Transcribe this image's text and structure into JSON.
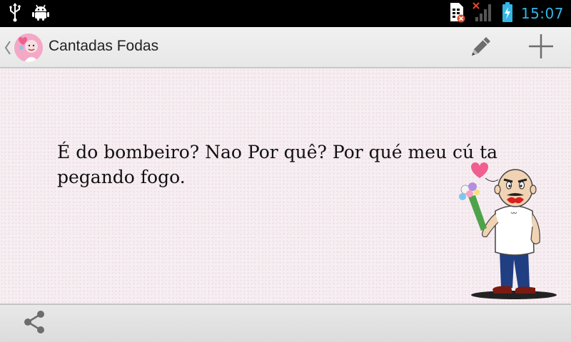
{
  "status_bar": {
    "time": "15:07",
    "time_color": "#34b5e5",
    "left_icons": [
      "usb-icon",
      "android-debug-icon"
    ],
    "right_icons": [
      "sim-missing-icon",
      "no-signal-icon",
      "battery-charging-icon"
    ]
  },
  "action_bar": {
    "title": "Cantadas Fodas",
    "actions": [
      "edit-icon",
      "add-icon"
    ]
  },
  "content": {
    "pickup_line": "É do bombeiro? Nao Por quê? Por qué meu cú ta pegando fogo."
  },
  "bottom_bar": {
    "actions": [
      "share-icon"
    ]
  },
  "colors": {
    "content_background": "#f7eef2",
    "heart": "#f05f8f",
    "accent_blue": "#34b5e5"
  }
}
